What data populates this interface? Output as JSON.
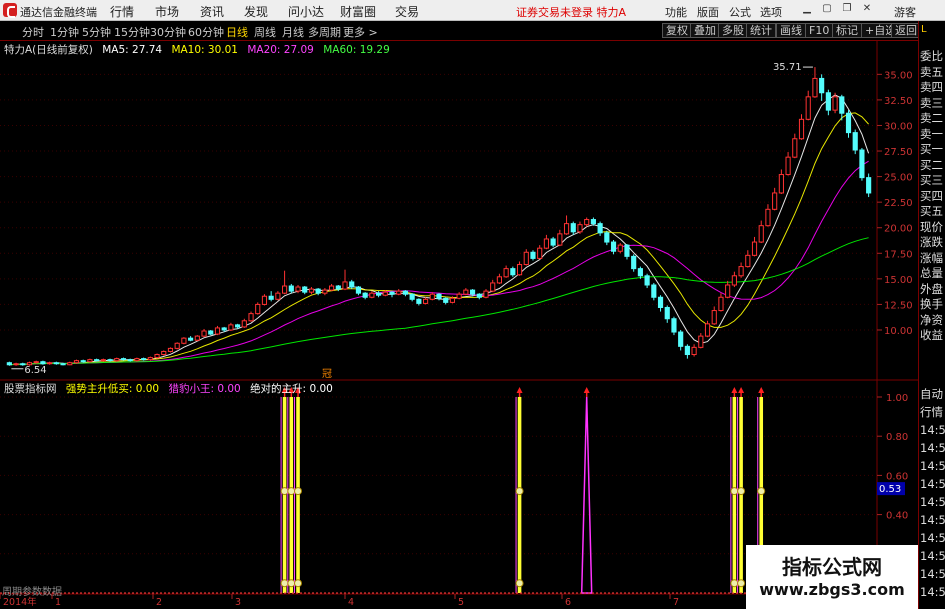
{
  "app": {
    "name": "通达信金融终端",
    "menus": [
      "行情",
      "市场",
      "资讯",
      "发现",
      "问小达",
      "财富圈",
      "交易"
    ],
    "login_warning": "证券交易未登录",
    "stock_title": "特力A",
    "right_menus": [
      "功能",
      "版面",
      "公式",
      "选项"
    ],
    "guest": "游客"
  },
  "tabs": {
    "periods": [
      "分时",
      "1分钟",
      "5分钟",
      "15分钟",
      "30分钟",
      "60分钟",
      "日线",
      "周线",
      "月线",
      "多周期",
      "更多 >"
    ],
    "active": "日线",
    "right_buttons": [
      "复权",
      "叠加",
      "多股",
      "统计",
      "画线",
      "F10",
      "标记",
      "+自选",
      "返回"
    ]
  },
  "sidebar": {
    "top": "L",
    "items": [
      "委比",
      "卖五",
      "卖四",
      "卖三",
      "卖二",
      "卖一",
      "买一",
      "买二",
      "买三",
      "买四",
      "买五",
      "现价",
      "涨跌",
      "涨幅",
      "总量",
      "外盘",
      "换手",
      "净资",
      "收益",
      "自动",
      "行情",
      "14:50",
      "14:50",
      "14:50",
      "14:50",
      "14:50",
      "14:50",
      "14:50",
      "14:50",
      "14:50",
      "14:50"
    ]
  },
  "main_legend": {
    "title": "特力A(日线前复权)",
    "ma5": "MA5: 27.74",
    "ma10": "MA10: 30.01",
    "ma20": "MA20: 27.09",
    "ma60": "MA60: 19.29",
    "ma5_color": "#ffffff",
    "ma10_color": "#ffff00",
    "ma20_color": "#ff00ff",
    "ma60_color": "#00ff00"
  },
  "indicator_legend": {
    "title": "股票指标网",
    "s1": "强势主升低买: 0.00",
    "s2": "猎豹小王: 0.00",
    "s3": "绝对的主升: 0.00"
  },
  "chart_data": {
    "type": "candlestick",
    "price_axis": {
      "ticks": [
        "35.00",
        "32.50",
        "30.00",
        "27.50",
        "25.00",
        "22.50",
        "20.00",
        "17.50",
        "15.00",
        "12.50",
        "10.00"
      ],
      "range": [
        5.5,
        36.5
      ]
    },
    "annotations": {
      "high": "35.71",
      "low": "6.54",
      "marker": "冠"
    },
    "indicator_axis": {
      "ticks": [
        "1.00",
        "0.80",
        "0.60",
        "0.40",
        "0.20"
      ],
      "current": "0.53"
    },
    "x_labels": [
      "2014年",
      "1",
      "2",
      "3",
      "4",
      "5",
      "6",
      "7"
    ],
    "candles": [
      [
        6.8,
        6.6,
        6.9,
        6.5
      ],
      [
        6.6,
        6.7,
        6.8,
        6.5
      ],
      [
        6.7,
        6.6,
        6.8,
        6.5
      ],
      [
        6.6,
        6.8,
        6.9,
        6.5
      ],
      [
        6.8,
        6.9,
        7.0,
        6.7
      ],
      [
        6.9,
        6.7,
        7.0,
        6.6
      ],
      [
        6.7,
        6.8,
        6.9,
        6.6
      ],
      [
        6.8,
        6.7,
        6.9,
        6.6
      ],
      [
        6.7,
        6.6,
        6.8,
        6.54
      ],
      [
        6.6,
        6.8,
        6.9,
        6.55
      ],
      [
        6.8,
        7.0,
        7.1,
        6.7
      ],
      [
        7.0,
        6.9,
        7.1,
        6.8
      ],
      [
        6.9,
        7.1,
        7.2,
        6.8
      ],
      [
        7.1,
        7.0,
        7.2,
        6.9
      ],
      [
        7.0,
        7.1,
        7.2,
        6.9
      ],
      [
        7.1,
        7.0,
        7.2,
        6.9
      ],
      [
        7.0,
        7.2,
        7.3,
        6.9
      ],
      [
        7.2,
        7.1,
        7.3,
        7.0
      ],
      [
        7.1,
        7.0,
        7.2,
        6.9
      ],
      [
        7.0,
        7.2,
        7.3,
        6.9
      ],
      [
        7.2,
        7.1,
        7.3,
        7.0
      ],
      [
        7.1,
        7.3,
        7.4,
        7.0
      ],
      [
        7.3,
        7.6,
        7.7,
        7.2
      ],
      [
        7.6,
        7.9,
        8.0,
        7.5
      ],
      [
        7.9,
        8.2,
        8.3,
        7.8
      ],
      [
        8.2,
        8.7,
        8.8,
        8.1
      ],
      [
        8.7,
        9.2,
        9.3,
        8.6
      ],
      [
        9.2,
        9.0,
        9.4,
        8.9
      ],
      [
        9.0,
        9.4,
        9.5,
        8.9
      ],
      [
        9.4,
        9.9,
        10.1,
        9.3
      ],
      [
        9.9,
        9.6,
        10.0,
        9.5
      ],
      [
        9.6,
        10.2,
        10.4,
        9.5
      ],
      [
        10.2,
        10.0,
        10.3,
        9.8
      ],
      [
        10.0,
        10.5,
        10.7,
        9.9
      ],
      [
        10.5,
        10.3,
        10.6,
        10.1
      ],
      [
        10.3,
        10.9,
        11.1,
        10.2
      ],
      [
        10.9,
        11.6,
        11.8,
        10.8
      ],
      [
        11.6,
        12.5,
        12.7,
        11.5
      ],
      [
        12.5,
        13.3,
        13.5,
        12.4
      ],
      [
        13.3,
        13.0,
        13.8,
        12.8
      ],
      [
        13.0,
        13.6,
        13.8,
        12.9
      ],
      [
        13.6,
        14.3,
        15.8,
        13.5
      ],
      [
        14.3,
        13.8,
        14.5,
        13.6
      ],
      [
        13.8,
        14.2,
        14.4,
        13.6
      ],
      [
        14.2,
        13.7,
        14.3,
        13.5
      ],
      [
        13.7,
        14.0,
        14.2,
        13.5
      ],
      [
        14.0,
        13.6,
        14.1,
        13.4
      ],
      [
        13.6,
        13.9,
        14.1,
        13.4
      ],
      [
        13.9,
        14.3,
        14.5,
        13.8
      ],
      [
        14.3,
        14.0,
        14.4,
        13.8
      ],
      [
        14.0,
        14.7,
        15.9,
        13.9
      ],
      [
        14.7,
        14.2,
        14.9,
        14.0
      ],
      [
        14.2,
        13.6,
        14.3,
        13.4
      ],
      [
        13.6,
        13.2,
        13.7,
        13.0
      ],
      [
        13.2,
        13.6,
        13.8,
        13.1
      ],
      [
        13.6,
        13.4,
        13.8,
        13.2
      ],
      [
        13.4,
        13.7,
        13.9,
        13.3
      ],
      [
        13.7,
        13.5,
        13.8,
        13.2
      ],
      [
        13.5,
        13.8,
        14.0,
        13.4
      ],
      [
        13.8,
        13.5,
        13.9,
        13.3
      ],
      [
        13.5,
        13.0,
        13.6,
        12.8
      ],
      [
        13.0,
        12.6,
        13.1,
        12.4
      ],
      [
        12.6,
        13.0,
        13.2,
        12.5
      ],
      [
        13.0,
        13.5,
        13.7,
        12.9
      ],
      [
        13.5,
        13.1,
        13.6,
        12.9
      ],
      [
        13.1,
        12.7,
        13.2,
        12.5
      ],
      [
        12.7,
        13.1,
        13.3,
        12.6
      ],
      [
        13.1,
        13.5,
        13.7,
        13.0
      ],
      [
        13.5,
        13.9,
        14.1,
        13.4
      ],
      [
        13.9,
        13.5,
        14.0,
        13.3
      ],
      [
        13.5,
        13.2,
        13.6,
        13.0
      ],
      [
        13.2,
        13.8,
        14.0,
        13.1
      ],
      [
        13.8,
        14.6,
        14.9,
        13.7
      ],
      [
        14.6,
        15.2,
        15.5,
        14.5
      ],
      [
        15.2,
        16.0,
        16.3,
        15.1
      ],
      [
        16.0,
        15.4,
        16.2,
        15.2
      ],
      [
        15.4,
        16.4,
        16.7,
        15.3
      ],
      [
        16.4,
        17.6,
        17.9,
        16.3
      ],
      [
        17.6,
        17.0,
        17.8,
        16.8
      ],
      [
        17.0,
        18.0,
        18.3,
        16.9
      ],
      [
        18.0,
        18.9,
        19.3,
        17.9
      ],
      [
        18.9,
        18.3,
        19.1,
        18.1
      ],
      [
        18.3,
        19.4,
        19.8,
        18.2
      ],
      [
        19.4,
        20.4,
        21.2,
        19.3
      ],
      [
        20.4,
        19.6,
        20.6,
        19.3
      ],
      [
        19.6,
        20.3,
        20.6,
        19.4
      ],
      [
        20.3,
        20.8,
        21.0,
        20.1
      ],
      [
        20.8,
        20.4,
        21.0,
        20.2
      ],
      [
        20.4,
        19.5,
        20.6,
        19.2
      ],
      [
        19.5,
        18.6,
        19.7,
        18.3
      ],
      [
        18.6,
        17.7,
        18.8,
        17.4
      ],
      [
        17.7,
        18.3,
        18.5,
        17.5
      ],
      [
        18.3,
        17.2,
        18.4,
        16.9
      ],
      [
        17.2,
        16.0,
        17.4,
        15.7
      ],
      [
        16.0,
        15.3,
        16.2,
        15.0
      ],
      [
        15.3,
        14.4,
        15.5,
        14.1
      ],
      [
        14.4,
        13.2,
        14.6,
        12.9
      ],
      [
        13.2,
        12.2,
        13.4,
        11.8
      ],
      [
        12.2,
        11.1,
        12.4,
        10.7
      ],
      [
        11.1,
        9.8,
        11.3,
        9.5
      ],
      [
        9.8,
        8.4,
        10.0,
        8.0
      ],
      [
        8.4,
        7.6,
        8.6,
        7.2
      ],
      [
        7.6,
        8.3,
        8.6,
        7.4
      ],
      [
        8.3,
        9.4,
        9.7,
        8.2
      ],
      [
        9.4,
        10.6,
        10.9,
        9.3
      ],
      [
        10.6,
        11.9,
        12.3,
        10.5
      ],
      [
        11.9,
        13.2,
        13.6,
        11.8
      ],
      [
        13.2,
        14.4,
        14.8,
        13.1
      ],
      [
        14.4,
        15.3,
        15.7,
        14.2
      ],
      [
        15.3,
        16.2,
        16.6,
        15.1
      ],
      [
        16.2,
        17.3,
        17.8,
        16.1
      ],
      [
        17.3,
        18.6,
        19.1,
        17.2
      ],
      [
        18.6,
        20.2,
        20.7,
        18.5
      ],
      [
        20.2,
        21.8,
        22.3,
        20.1
      ],
      [
        21.8,
        23.4,
        23.9,
        21.7
      ],
      [
        23.4,
        25.2,
        25.7,
        23.3
      ],
      [
        25.2,
        26.9,
        27.4,
        25.1
      ],
      [
        26.9,
        28.7,
        29.2,
        26.8
      ],
      [
        28.7,
        30.6,
        31.1,
        28.6
      ],
      [
        30.6,
        32.8,
        33.4,
        30.5
      ],
      [
        32.8,
        34.6,
        35.71,
        32.7
      ],
      [
        34.6,
        33.2,
        35.0,
        32.4
      ],
      [
        33.2,
        31.5,
        33.5,
        31.0
      ],
      [
        31.5,
        32.8,
        33.2,
        31.2
      ],
      [
        32.8,
        31.2,
        33.0,
        30.5
      ],
      [
        31.2,
        29.3,
        31.5,
        28.8
      ],
      [
        29.3,
        27.6,
        29.6,
        27.2
      ],
      [
        27.6,
        24.9,
        27.8,
        24.6
      ],
      [
        24.9,
        23.4,
        25.3,
        23.0
      ]
    ],
    "signals": [
      {
        "i": 41,
        "series": "强势主升低买",
        "height": 1.0
      },
      {
        "i": 42,
        "series": "强势主升低买",
        "height": 1.0
      },
      {
        "i": 43,
        "series": "强势主升低买",
        "height": 1.0
      },
      {
        "i": 76,
        "series": "强势主升低买",
        "height": 1.0
      },
      {
        "i": 86,
        "series": "猎豹小王",
        "height": 1.0
      },
      {
        "i": 108,
        "series": "强势主升低买",
        "height": 1.0
      },
      {
        "i": 109,
        "series": "强势主升低买",
        "height": 1.0
      },
      {
        "i": 112,
        "series": "强势主升低买",
        "height": 1.0
      }
    ]
  },
  "watermark": {
    "cn": "指标公式网",
    "url": "www.zbgs3.com"
  },
  "footer_tag": "周期参数数据"
}
